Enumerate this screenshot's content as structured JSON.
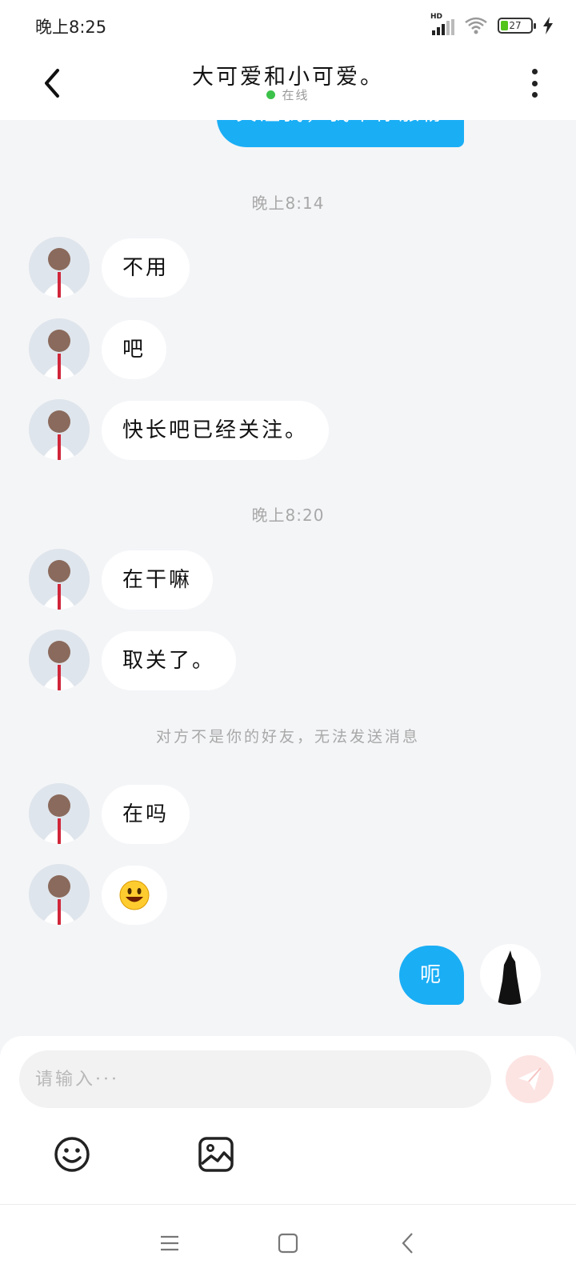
{
  "status_bar": {
    "time": "晚上8:25",
    "network": "HD",
    "battery": "27"
  },
  "header": {
    "title": "大可爱和小可爱。",
    "status": "在线"
  },
  "messages": {
    "top_partial": {
      "text": "关注我，我带你涨粉"
    },
    "timestamp1": "晚上8:14",
    "m1": "不用",
    "m2": "吧",
    "m3": "快长吧已经关注。",
    "timestamp2": "晚上8:20",
    "m4": "在干嘛",
    "m5": "取关了。",
    "system_note": "对方不是你的好友，无法发送消息",
    "m6": "在吗",
    "m7_icon": "smiley-emoji",
    "m8": "呃"
  },
  "input": {
    "placeholder": "请输入···"
  },
  "toolbar": {
    "emoji_icon": "smiley-icon",
    "image_icon": "image-icon",
    "send_icon": "send-icon"
  },
  "colors": {
    "accent": "#1aaef5",
    "online": "#3cc24a",
    "send_disabled": "#fce4e3"
  }
}
